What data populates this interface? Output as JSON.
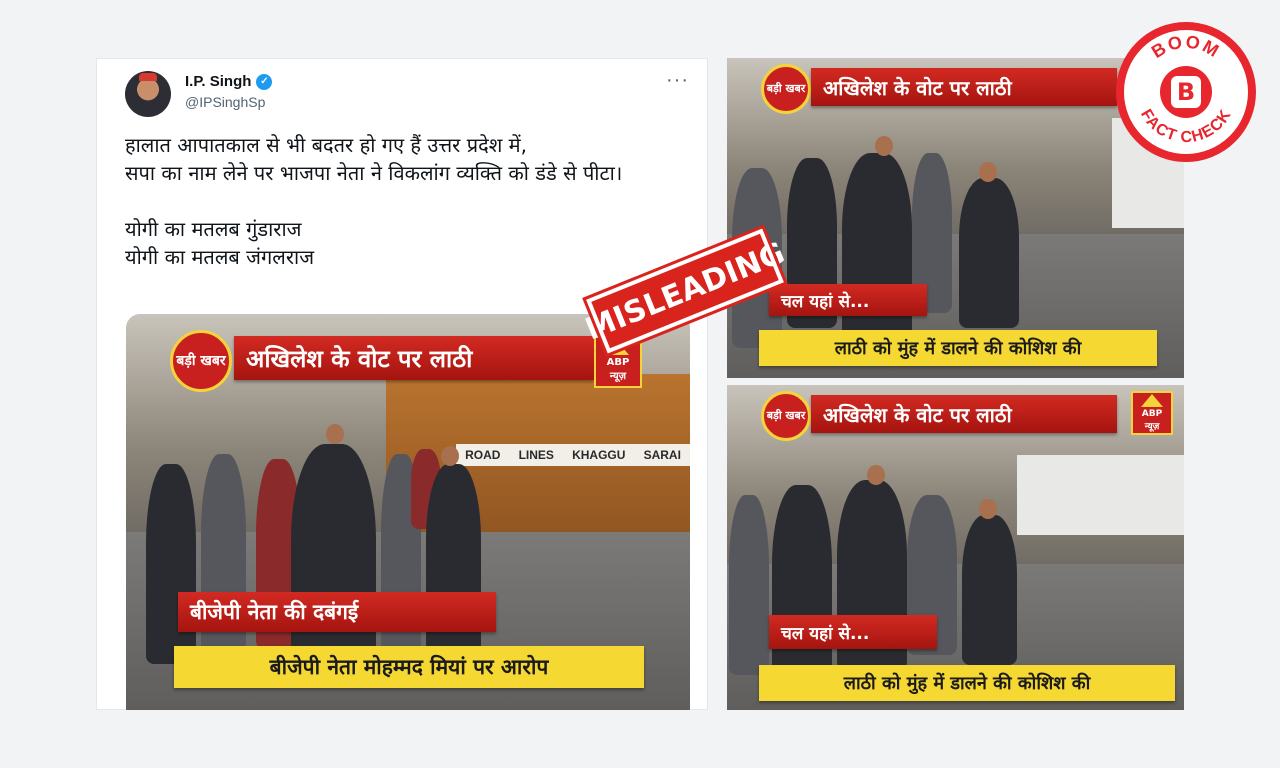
{
  "tweet": {
    "name": "I.P. Singh",
    "handle": "@IPSinghSp",
    "more": "···",
    "text": "हालात आपातकाल से भी बदतर हो गए हैं उत्तर प्रदेश में,\n सपा का नाम लेने पर भाजपा नेता ने विकलांग व्यक्ति को डंडे से पीटा।\n\nयोगी का मतलब गुंडाराज\nयोगी का मतलब जंगलराज"
  },
  "video_main": {
    "badge": "बड़ी खबर",
    "headline": "अखिलेश के वोट पर लाठी",
    "channel": "ABP",
    "channel_sub": "न्यूज़",
    "truck_text": [
      "ROAD",
      "LINES",
      "KHAGGU",
      "SARAI"
    ],
    "red_caption": "बीजेपी नेता की दबंगई",
    "yellow_caption": "बीजेपी नेता मोहम्मद मियां पर आरोप"
  },
  "video_top": {
    "badge": "बड़ी खबर",
    "headline": "अखिलेश के वोट पर लाठी",
    "red_caption": "चल यहां से...",
    "yellow_caption": "लाठी को मुंह में डालने की कोशिश की"
  },
  "video_bottom": {
    "badge": "बड़ी खबर",
    "headline": "अखिलेश के वोट पर लाठी",
    "channel": "ABP",
    "channel_sub": "न्यूज़",
    "red_caption": "चल यहां से...",
    "yellow_caption": "लाठी को मुंह में डालने की कोशिश की"
  },
  "stamp": {
    "label": "MISLEADING"
  },
  "boom_logo": {
    "top": "BOOM",
    "bottom": "FACT CHECK",
    "letter": "B"
  },
  "colors": {
    "stamp_red": "#d9231d",
    "boom_red": "#e8262e",
    "verified_blue": "#1d9bf0",
    "caption_yellow": "#f6d832"
  }
}
